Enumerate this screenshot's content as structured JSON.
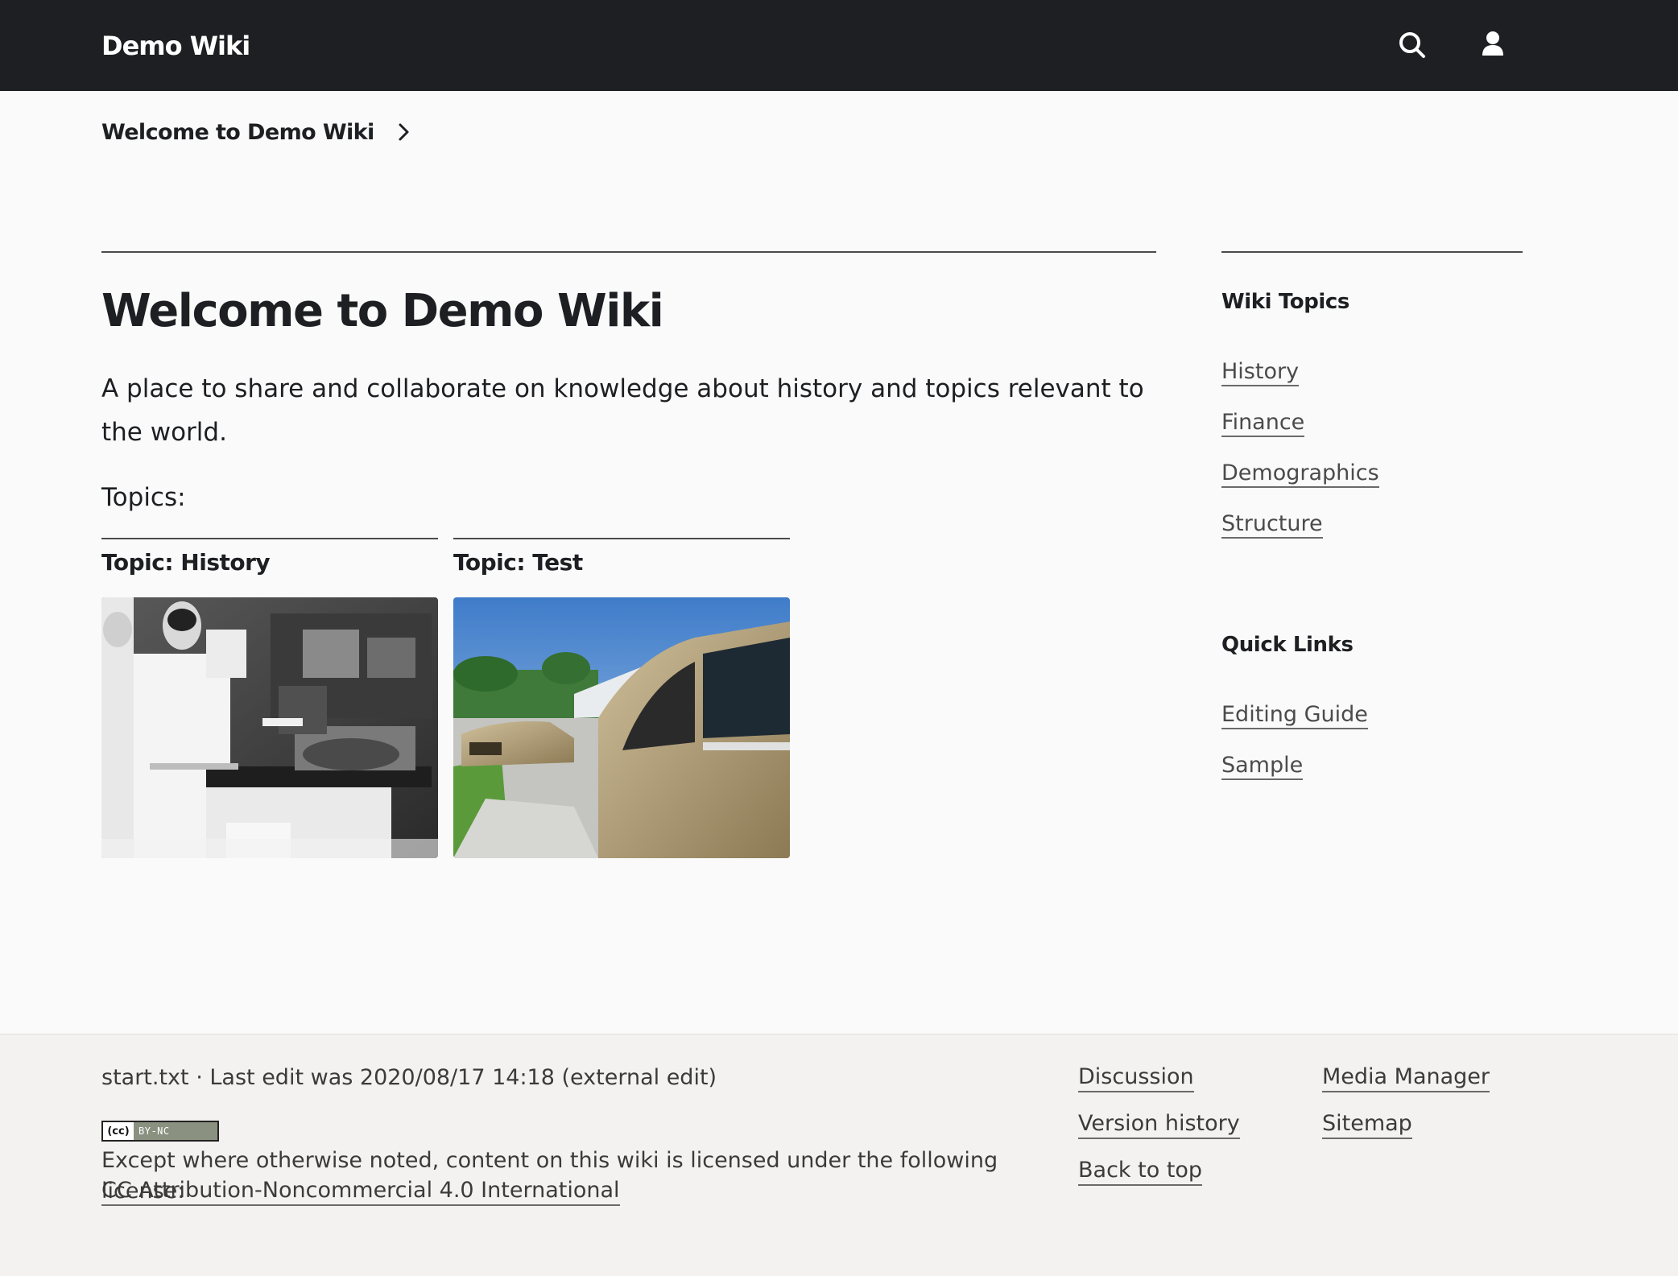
{
  "header": {
    "site_title": "Demo Wiki"
  },
  "breadcrumb": {
    "items": [
      {
        "label": "Welcome to Demo Wiki"
      }
    ]
  },
  "main": {
    "title": "Welcome to Demo Wiki",
    "intro": "A place to share and collaborate on knowledge about history and topics relevant to the world.",
    "topics_label": "Topics:",
    "cards": [
      {
        "title": "Topic: History",
        "image": "black-and-white photo of a man in a white coat cutting meat at a butcher counter"
      },
      {
        "title": "Topic: Test",
        "image": "color photo of vintage gold cars parked in a sunny driveway"
      }
    ]
  },
  "sidebar": {
    "wiki_topics": {
      "heading": "Wiki Topics",
      "links": [
        {
          "label": "History"
        },
        {
          "label": "Finance"
        },
        {
          "label": "Demographics"
        },
        {
          "label": "Structure"
        }
      ]
    },
    "quick_links": {
      "heading": "Quick Links",
      "links": [
        {
          "label": "Editing Guide"
        },
        {
          "label": "Sample"
        }
      ]
    }
  },
  "footer": {
    "meta": "start.txt · Last edit was 2020/08/17 14:18 (external edit)",
    "cc_badge": {
      "left": "(cc)",
      "right": "BY-NC"
    },
    "license_text": "Except where otherwise noted, content on this wiki is licensed under the following license:",
    "license_link": "CC Attribution-Noncommercial 4.0 International",
    "links_col1": [
      {
        "label": "Discussion"
      },
      {
        "label": "Version history"
      },
      {
        "label": "Back to top"
      }
    ],
    "links_col2": [
      {
        "label": "Media Manager"
      },
      {
        "label": "Sitemap"
      }
    ]
  },
  "icons": {
    "search": "search-icon",
    "user": "user-icon",
    "breadcrumb_separator": "chevron-right-icon"
  },
  "colors": {
    "header_bg": "#1d1f22",
    "page_bg": "#fafafa",
    "footer_bg": "#f3f2f1",
    "text": "#1d1f22",
    "link": "#4b4b4b"
  }
}
